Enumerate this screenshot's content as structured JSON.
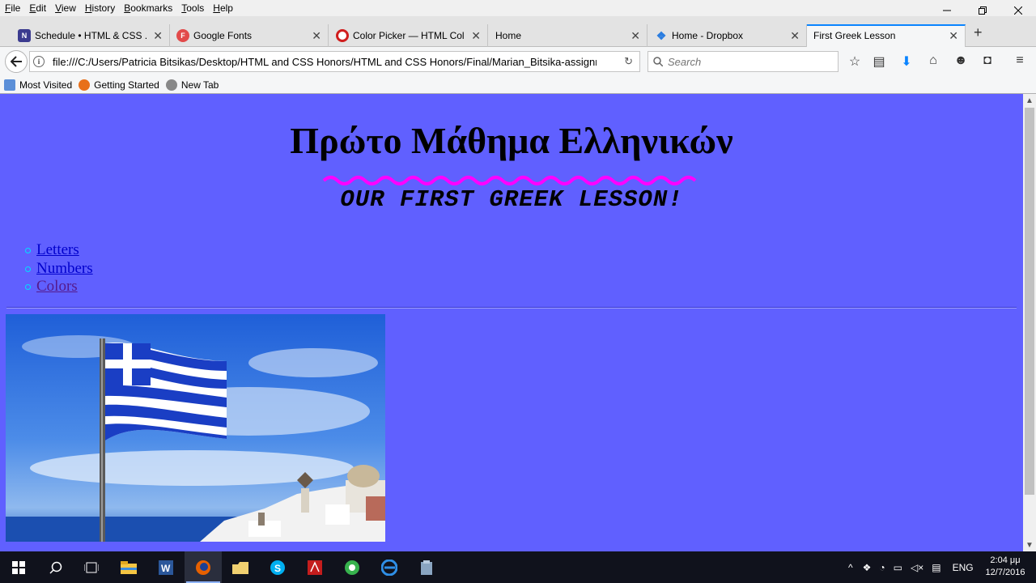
{
  "menu": [
    "File",
    "Edit",
    "View",
    "History",
    "Bookmarks",
    "Tools",
    "Help"
  ],
  "tabs": [
    {
      "label": "Schedule • HTML & CSS ...",
      "icon": "onenote-icon"
    },
    {
      "label": "Google Fonts",
      "icon": "google-fonts-icon"
    },
    {
      "label": "Color Picker — HTML Col...",
      "icon": "color-picker-icon"
    },
    {
      "label": "Home",
      "icon": ""
    },
    {
      "label": "Home - Dropbox",
      "icon": "dropbox-icon"
    },
    {
      "label": "First Greek Lesson",
      "icon": ""
    }
  ],
  "active_tab_index": 5,
  "url": "file:///C:/Users/Patricia Bitsikas/Desktop/HTML and CSS Honors/HTML and CSS Honors/Final/Marian_Bitsika-assignme",
  "search": {
    "placeholder": "Search"
  },
  "bookmarks": [
    "Most Visited",
    "Getting Started",
    "New Tab"
  ],
  "page": {
    "title": "Πρώτο Μάθημα Ελληνικών",
    "subtitle": "OUR FIRST GREEK LESSON!",
    "nav": [
      {
        "label": "Letters",
        "visited": false
      },
      {
        "label": "Numbers",
        "visited": false
      },
      {
        "label": "Colors",
        "visited": true
      }
    ],
    "image_description": "Greek flag waving over Santorini"
  },
  "colors": {
    "page_background": "#6060ff",
    "wave": "#ff00ff",
    "link": "#0000cc",
    "visited_link": "#551a8b",
    "bullet": "#00e0ff",
    "active_tab_accent": "#0a84ff"
  },
  "taskbar": {
    "apps": [
      "windows-start-icon",
      "search-icon",
      "task-view-icon",
      "file-explorer-icon",
      "word-icon",
      "firefox-icon",
      "folder-icon",
      "skype-icon",
      "acrobat-icon",
      "app-icon",
      "edge-icon",
      "app-icon-2"
    ],
    "language": "ENG",
    "time": "2:04 μμ",
    "date": "12/7/2016"
  }
}
